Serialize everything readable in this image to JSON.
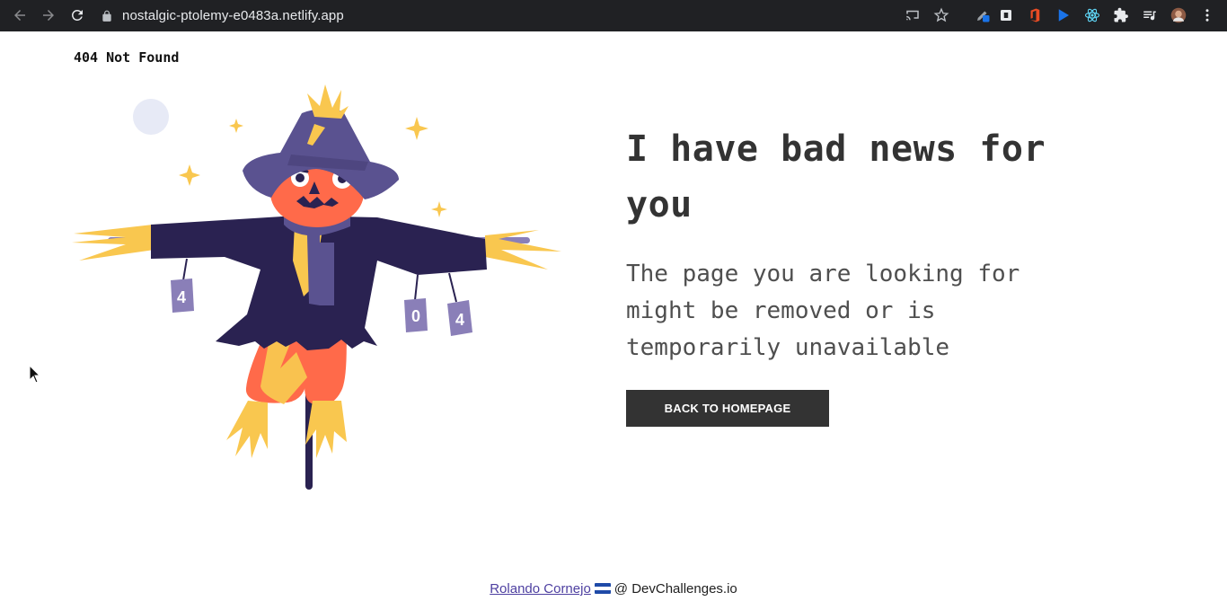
{
  "browser": {
    "url": "nostalgic-ptolemy-e0483a.netlify.app"
  },
  "page": {
    "site_title": "404 Not Found",
    "headline": "I have bad news for you",
    "subtext": "The page you are looking for might be removed or is temporarily unavailable",
    "cta_label": "BACK TO HOMEPAGE"
  },
  "illustration": {
    "left_can": "4",
    "middle_can": "0",
    "right_can": "4"
  },
  "footer": {
    "author": "Rolando Cornejo",
    "suffix": "@ DevChallenges.io"
  },
  "colors": {
    "button_bg": "#333333",
    "headline": "#333333",
    "hat": "#5a5290",
    "coat": "#2a2251",
    "face": "#ff6a4a",
    "straw": "#f9c74f",
    "link": "#4d3fa0"
  }
}
